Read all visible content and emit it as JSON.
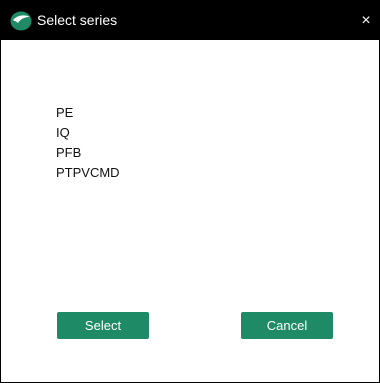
{
  "window": {
    "title": "Select series",
    "close_glyph": "×",
    "app_icon": "app-logo-icon"
  },
  "series": {
    "items": [
      {
        "label": "PE"
      },
      {
        "label": "IQ"
      },
      {
        "label": "PFB"
      },
      {
        "label": "PTPVCMD"
      }
    ]
  },
  "buttons": {
    "select_label": "Select",
    "cancel_label": "Cancel"
  },
  "colors": {
    "titlebar": "#000000",
    "button": "#1e8a66",
    "icon": "#1e8a66"
  }
}
